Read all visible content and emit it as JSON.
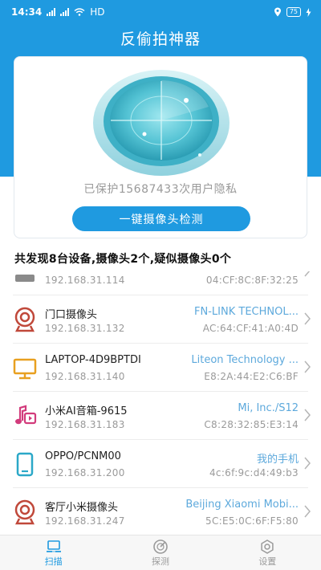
{
  "status_bar": {
    "time": "14:34",
    "network": "HD",
    "battery": "75"
  },
  "app_title": "反偷拍神器",
  "protect_text": "已保护15687433次用户隐私",
  "detect_button": "一键摄像头检测",
  "summary": "共发现8台设备,摄像头2个,疑似摄像头0个",
  "devices": [
    {
      "name": "",
      "ip": "192.168.31.114",
      "vendor": "",
      "mac": "04:CF:8C:8F:32:25",
      "icon": "router-icon"
    },
    {
      "name": "门口摄像头",
      "ip": "192.168.31.132",
      "vendor": "FN-LINK TECHNOL...",
      "mac": "AC:64:CF:41:A0:4D",
      "icon": "webcam-icon"
    },
    {
      "name": "LAPTOP-4D9BPTDI",
      "ip": "192.168.31.140",
      "vendor": "Liteon Technology ...",
      "mac": "E8:2A:44:E2:C6:BF",
      "icon": "monitor-icon"
    },
    {
      "name": "小米AI音箱-9615",
      "ip": "192.168.31.183",
      "vendor": "Mi, Inc./S12",
      "mac": "C8:28:32:85:E3:14",
      "icon": "music-icon"
    },
    {
      "name": "OPPO/PCNM00",
      "ip": "192.168.31.200",
      "vendor": "我的手机",
      "mac": "4c:6f:9c:d4:49:b3",
      "icon": "phone-icon"
    },
    {
      "name": "客厅小米摄像头",
      "ip": "192.168.31.247",
      "vendor": "Beijing Xiaomi Mobi...",
      "mac": "5C:E5:0C:6F:F5:80",
      "icon": "webcam-icon"
    }
  ],
  "nav": {
    "scan": "扫描",
    "probe": "探测",
    "settings": "设置"
  },
  "colors": {
    "primary": "#1f9ae0",
    "vendor_text": "#5da9dc",
    "icon_orange": "#e8a020",
    "icon_red": "#c0483a",
    "icon_pink": "#d23b7c",
    "icon_teal": "#2ba8c8"
  }
}
